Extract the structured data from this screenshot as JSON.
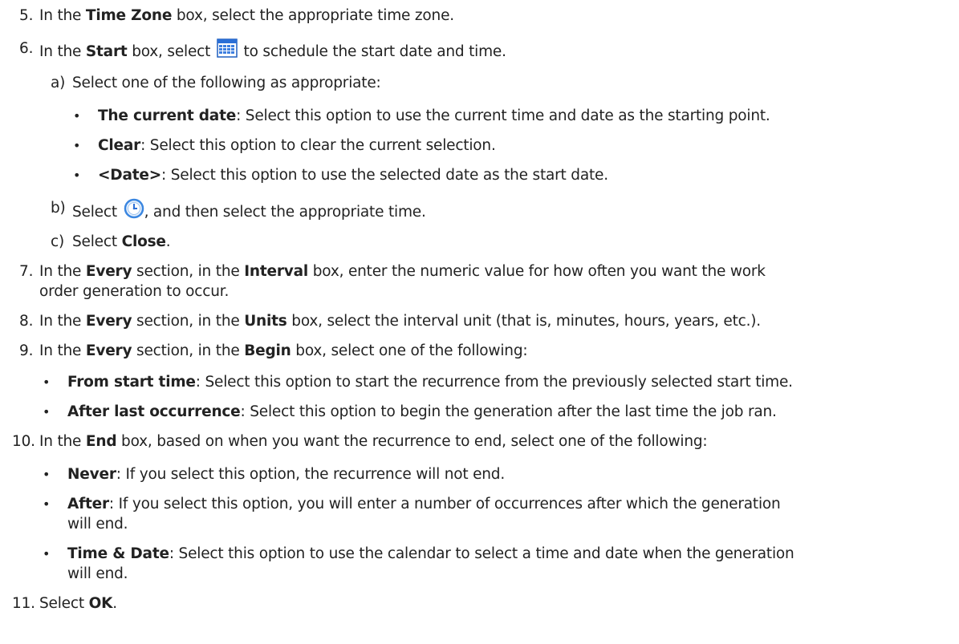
{
  "steps": {
    "s5": {
      "num": "5.",
      "pre": "In the ",
      "bold": "Time Zone",
      "post": " box, select the appropriate time zone."
    },
    "s6": {
      "num": "6.",
      "pre": "In the ",
      "bold": "Start",
      "mid": " box, select ",
      "post": " to schedule the start date and time.",
      "subs": {
        "a": {
          "letter": "a)",
          "text": "Select one of the following as appropriate:",
          "bullets": [
            {
              "bold": "The current date",
              "text": ": Select this option to use the current time and date as the starting point."
            },
            {
              "bold": "Clear",
              "text": ": Select this option to clear the current selection."
            },
            {
              "bold": "<Date>",
              "text": ": Select this option to use the selected date as the start date."
            }
          ]
        },
        "b": {
          "letter": "b)",
          "pre": "Select ",
          "post": ", and then select the appropriate time."
        },
        "c": {
          "letter": "c)",
          "pre": "Select ",
          "bold": "Close",
          "post": "."
        }
      }
    },
    "s7": {
      "num": "7.",
      "pre": "In the ",
      "bold1": "Every",
      "mid": " section, in the ",
      "bold2": "Interval",
      "post": " box, enter the numeric value for how often you want the work",
      "line2": "order generation to occur."
    },
    "s8": {
      "num": "8.",
      "pre": "In the ",
      "bold1": "Every",
      "mid": " section, in the ",
      "bold2": "Units",
      "post": " box, select the interval unit (that is, minutes, hours, years, etc.)."
    },
    "s9": {
      "num": "9.",
      "pre": "In the ",
      "bold1": "Every",
      "mid": " section, in the ",
      "bold2": "Begin",
      "post": " box, select one of the following:",
      "bullets": [
        {
          "bold": "From start time",
          "text": ": Select this option to start the recurrence from the previously selected start time."
        },
        {
          "bold": "After last occurrence",
          "text": ": Select this option to begin the generation after the last time the job ran."
        }
      ]
    },
    "s10": {
      "num": "10.",
      "pre": "In the ",
      "bold": "End",
      "post": " box, based on when you want the recurrence to end, select one of the following:",
      "bullets": [
        {
          "bold": "Never",
          "text": ": If you select this option, the recurrence will not end."
        },
        {
          "bold": "After",
          "text": ": If you select this option, you will enter a number of occurrences after which the generation",
          "line2": "will end."
        },
        {
          "bold": "Time & Date",
          "text": ": Select this option to use the calendar to select a time and date when the generation",
          "line2": "will end."
        }
      ]
    },
    "s11": {
      "num": "11.",
      "pre": "Select ",
      "bold": "OK",
      "post": "."
    }
  },
  "icons": {
    "calendar": "calendar-icon",
    "clock": "clock-icon"
  },
  "colors": {
    "text": "#222222",
    "calendar_blue": "#2b6fd6",
    "clock_blue": "#3a86e0"
  }
}
